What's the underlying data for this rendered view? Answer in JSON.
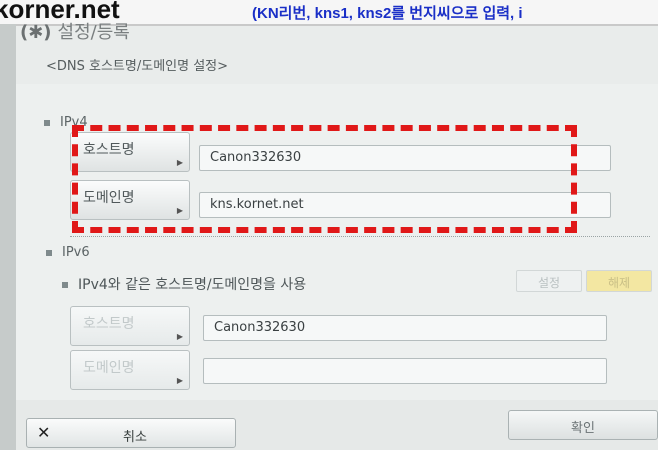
{
  "banner": {
    "main": "korner.net",
    "note": "(KN리번, kns1, kns2를 번지씨으로 입력, i"
  },
  "header": {
    "mark": "(✱)",
    "title": "설정/등록"
  },
  "page": {
    "subtitle": "<DNS 호스트명/도메인명 설정>"
  },
  "ipv4": {
    "label": "IPv4",
    "host_label": "호스트명",
    "host_value": "Canon332630",
    "domain_label": "도메인명",
    "domain_value": "kns.kornet.net"
  },
  "ipv6": {
    "label": "IPv6",
    "option_label": "IPv4와 같은 호스트명/도메인명을 사용",
    "toggle_on": "설정",
    "toggle_off": "해제",
    "host_label": "호스트명",
    "host_value": "Canon332630",
    "domain_label": "도메인명",
    "domain_value": ""
  },
  "footer": {
    "cancel_icon": "✕",
    "cancel_label": "취소",
    "ok_label": "확인"
  },
  "colors": {
    "highlight": "#e01818",
    "banner_note": "#1a2fc7",
    "toggle_selected": "#f3e7a2"
  },
  "icons": {
    "arrow": "chevron-right-icon",
    "cancel": "close-icon"
  }
}
